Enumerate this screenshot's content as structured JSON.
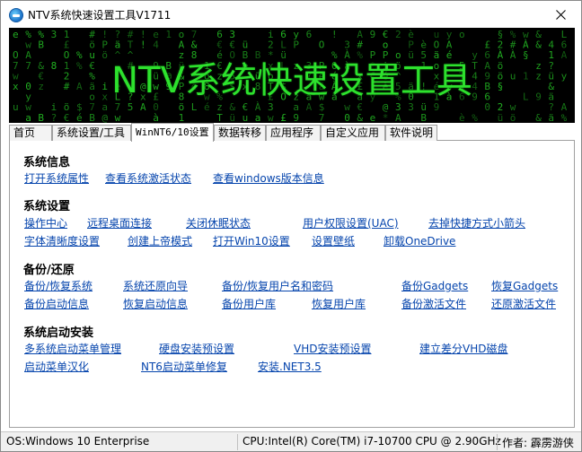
{
  "window": {
    "title": "NTV系统快速设置工具V1711",
    "banner_title": "NTV系统快速设置工具"
  },
  "icons": {
    "app": "app-globe-icon",
    "close": "close-icon"
  },
  "colors": {
    "banner_text": "#2de12d",
    "matrix_text": "#22b422",
    "link": "#0645ad"
  },
  "tabs": [
    {
      "label": "首页"
    },
    {
      "label": "系统设置/工具"
    },
    {
      "label": "WinNT6/10设置",
      "active": true
    },
    {
      "label": "数据转移"
    },
    {
      "label": "应用程序"
    },
    {
      "label": "自定义应用"
    },
    {
      "label": "软件说明"
    }
  ],
  "sections": {
    "sysinfo": {
      "title": "系统信息",
      "links": [
        "打开系统属性",
        "查看系统激活状态",
        "查看windows版本信息"
      ]
    },
    "syssettings": {
      "title": "系统设置",
      "links": [
        "操作中心",
        "远程桌面连接",
        "关闭休眠状态",
        "用户权限设置(UAC)",
        "去掉快捷方式小箭头",
        "字体清晰度设置",
        "创建上帝模式",
        "打开Win10设置",
        "设置壁纸",
        "卸载OneDrive"
      ]
    },
    "backup": {
      "title": "备份/还原",
      "links": [
        "备份/恢复系统",
        "系统还原向导",
        "备份/恢复用户名和密码",
        "备份Gadgets",
        "恢复Gadgets",
        "备份启动信息",
        "恢复启动信息",
        "备份用户库",
        "恢复用户库",
        "备份激活文件",
        "还原激活文件"
      ]
    },
    "boot": {
      "title": "系统启动安装",
      "links": [
        "多系统启动菜单管理",
        "硬盘安装预设置",
        "VHD安装预设置",
        "建立差分VHD磁盘",
        "启动菜单汉化",
        "NT6启动菜单修复",
        "安装.NET3.5"
      ]
    }
  },
  "status": {
    "os": "OS:Windows 10 Enterprise",
    "cpu": "CPU:Intel(R) Core(TM) i7-10700 CPU @ 2.90GHz",
    "author": "作者: 霹雳游侠"
  }
}
